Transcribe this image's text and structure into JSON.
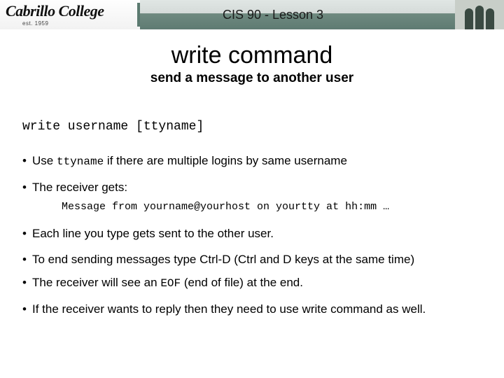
{
  "banner": {
    "logo_name": "Cabrillo College",
    "logo_est": "est. 1959",
    "title": "CIS 90 - Lesson 3"
  },
  "heading": {
    "h1": "write command",
    "h2": "send a message to another user"
  },
  "syntax": "write username [ttyname]",
  "bullets": {
    "b1_pre": "Use ",
    "b1_code": "ttyname",
    "b1_post": " if there are multiple logins by same username",
    "b2": "The receiver gets:",
    "b2_sub": "Message from yourname@yourhost on yourtty at hh:mm …",
    "b3": "Each line you type gets sent to the other user.",
    "b4": "To end sending messages type Ctrl-D (Ctrl and D keys at the same time)",
    "b5_pre": "The receiver will see an ",
    "b5_code": "EOF",
    "b5_post": " (end of file) at the end.",
    "b6": "If the receiver wants to reply then they need to use write command as well."
  }
}
